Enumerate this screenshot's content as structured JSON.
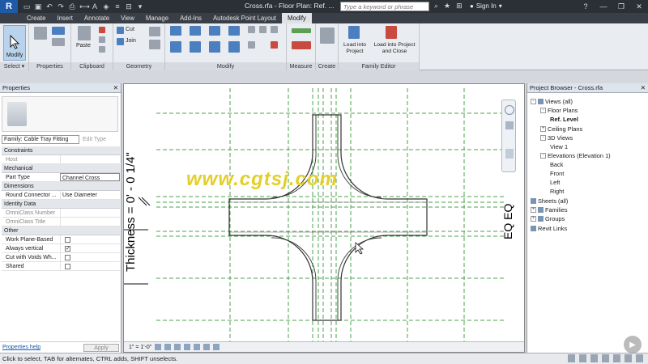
{
  "titlebar": {
    "app_logo": "R",
    "window_title": "Cross.rfa - Floor Plan: Ref. ...",
    "search_placeholder": "Type a keyword or phrase",
    "sign_in": "Sign In",
    "icons": [
      "binoculars-icon",
      "star-icon",
      "cart-icon",
      "user-icon",
      "help-icon"
    ]
  },
  "tabs": [
    "Create",
    "Insert",
    "Annotate",
    "View",
    "Manage",
    "Add-Ins",
    "Autodesk Point Layout",
    "Modify"
  ],
  "active_tab": "Modify",
  "ribbon": {
    "panels": {
      "select": "Select ▾",
      "properties": "Properties",
      "clipboard": "Clipboard",
      "geometry": "Geometry",
      "modify": "Modify",
      "measure": "Measure",
      "create": "Create",
      "family_editor": "Family Editor"
    },
    "modify_label": "Modify",
    "paste_label": "Paste",
    "cut_label": "Cut",
    "join_label": "Join",
    "load_project": "Load into Project",
    "load_project_close": "Load into Project and Close"
  },
  "properties": {
    "title": "Properties",
    "family_type": "Family: Cable Tray Fitting",
    "edit_type": "Edit Type",
    "sections": [
      {
        "name": "Constraints",
        "rows": [
          {
            "k": "Host",
            "v": "",
            "dim": true
          }
        ]
      },
      {
        "name": "Mechanical",
        "rows": [
          {
            "k": "Part Type",
            "v": "Channel Cross",
            "input": true
          }
        ]
      },
      {
        "name": "Dimensions",
        "rows": [
          {
            "k": "Round Connector ...",
            "v": "Use Diameter"
          }
        ]
      },
      {
        "name": "Identity Data",
        "rows": [
          {
            "k": "OmniClass Number",
            "v": "",
            "dim": true
          },
          {
            "k": "OmniClass Title",
            "v": "",
            "dim": true
          }
        ]
      },
      {
        "name": "Other",
        "rows": [
          {
            "k": "Work Plane-Based",
            "check": false
          },
          {
            "k": "Always vertical",
            "check": true
          },
          {
            "k": "Cut with Voids Wh...",
            "check": false
          },
          {
            "k": "Shared",
            "check": false
          }
        ]
      }
    ],
    "help_link": "Properties help",
    "apply": "Apply"
  },
  "canvas": {
    "dimension_text": "Thickness = 0' - 0 1/4\"",
    "eq_text": "EQ EQ",
    "watermark": "www.cgtsj.com",
    "scale": "1\" = 1'-0\""
  },
  "browser": {
    "title": "Project Browser - Cross.rfa",
    "items": [
      {
        "label": "Views (all)",
        "level": 0,
        "toggle": "-"
      },
      {
        "label": "Floor Plans",
        "level": 1,
        "toggle": "-"
      },
      {
        "label": "Ref. Level",
        "level": 2,
        "bold": true
      },
      {
        "label": "Ceiling Plans",
        "level": 1,
        "toggle": "+"
      },
      {
        "label": "3D Views",
        "level": 1,
        "toggle": "-"
      },
      {
        "label": "View 1",
        "level": 2
      },
      {
        "label": "Elevations (Elevation 1)",
        "level": 1,
        "toggle": "-"
      },
      {
        "label": "Back",
        "level": 2
      },
      {
        "label": "Front",
        "level": 2
      },
      {
        "label": "Left",
        "level": 2
      },
      {
        "label": "Right",
        "level": 2
      },
      {
        "label": "Sheets (all)",
        "level": 0
      },
      {
        "label": "Families",
        "level": 0,
        "toggle": "+"
      },
      {
        "label": "Groups",
        "level": 0,
        "toggle": "+"
      },
      {
        "label": "Revit Links",
        "level": 0
      }
    ]
  },
  "status_bar": {
    "hint": "Click to select, TAB for alternates, CTRL adds, SHIFT unselects."
  },
  "colors": {
    "ref_plane": "#4da04d",
    "watermark": "#e3cf2c",
    "accent": "#1e5aa8"
  }
}
